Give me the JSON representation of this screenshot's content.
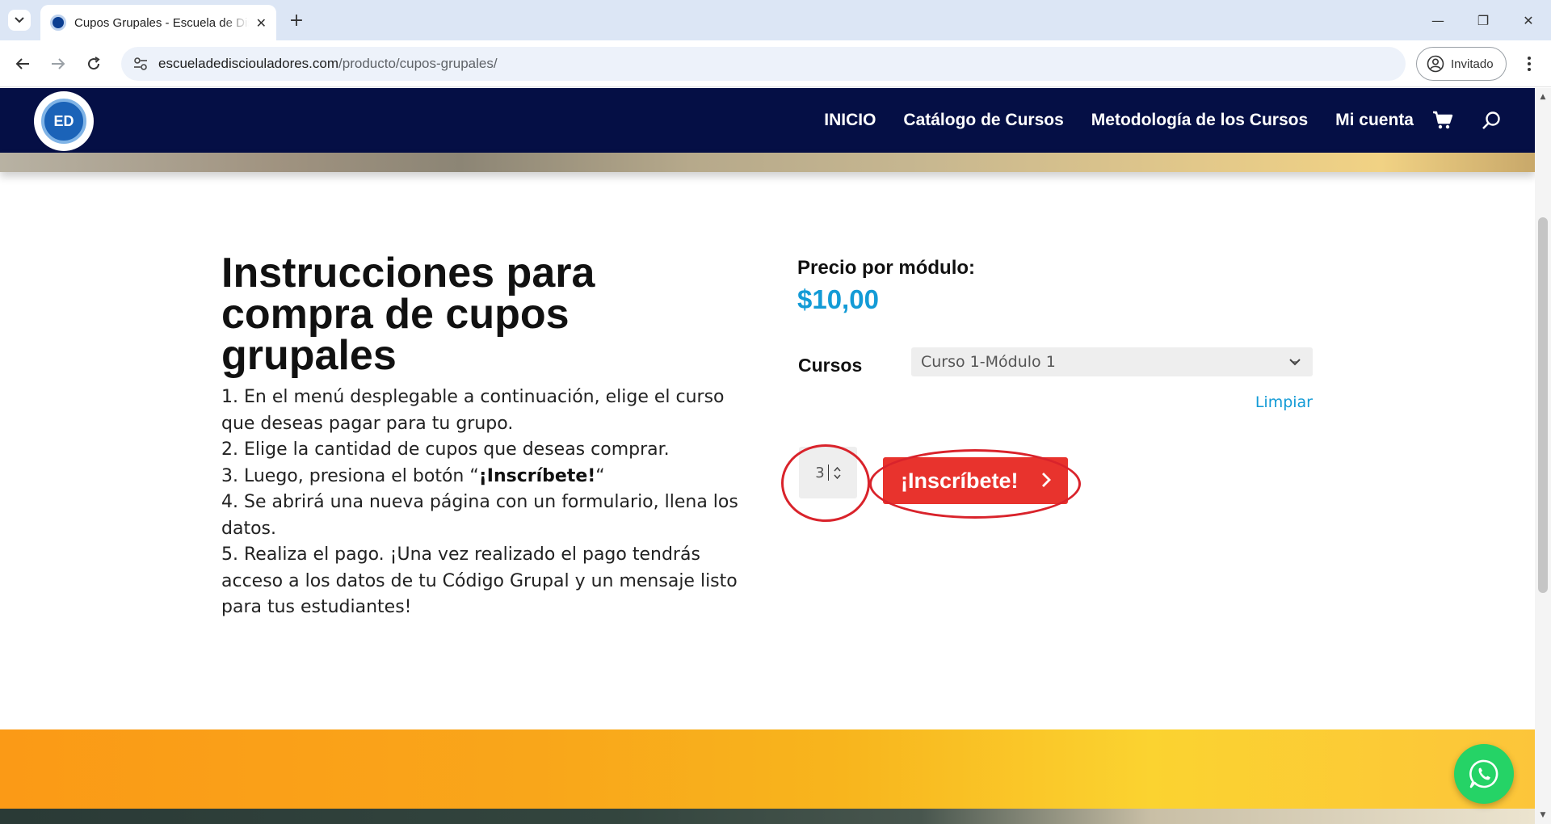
{
  "browser": {
    "tab_title": "Cupos Grupales - Escuela de Discipuladores",
    "tab_close": "✕",
    "new_tab": "+",
    "url_domain": "escueladedisciouladores.com",
    "url_path": "/producto/cupos-grupales/",
    "profile_label": "Invitado",
    "window": {
      "minimize": "—",
      "restore": "❐",
      "close": "✕"
    }
  },
  "site": {
    "logo_text": "ED",
    "nav": [
      {
        "label": "INICIO"
      },
      {
        "label": "Catálogo de Cursos"
      },
      {
        "label": "Metodología de los Cursos"
      },
      {
        "label": "Mi cuenta"
      }
    ]
  },
  "instructions": {
    "title": "Instrucciones para compra de cupos grupales",
    "steps": {
      "s1": "1. En el menú desplegable a continuación, elige el curso que deseas pagar para tu grupo.",
      "s2": "2. Elige la cantidad de cupos que deseas comprar.",
      "s3_prefix": "3. Luego, presiona el botón “",
      "s3_bold": "¡Inscríbete!",
      "s3_suffix": "“",
      "s4": "4. Se abrirá una nueva página con un formulario, llena los datos.",
      "s5": "5. Realiza el pago. ¡Una vez realizado el pago tendrás acceso a los datos de tu Código Grupal y un mensaje listo para tus estudiantes!"
    }
  },
  "product": {
    "price_label": "Precio por módulo:",
    "price_value": "$10,00",
    "courses_label": "Cursos",
    "course_selected": "Curso 1-Módulo 1",
    "clear_label": "Limpiar",
    "quantity": "3",
    "enroll_label": "¡Inscríbete!"
  },
  "colors": {
    "header_bg": "#050f45",
    "accent_blue": "#139bd6",
    "button_red": "#e8332d",
    "annotation_red": "#d9232b",
    "whatsapp_green": "#25d366"
  }
}
